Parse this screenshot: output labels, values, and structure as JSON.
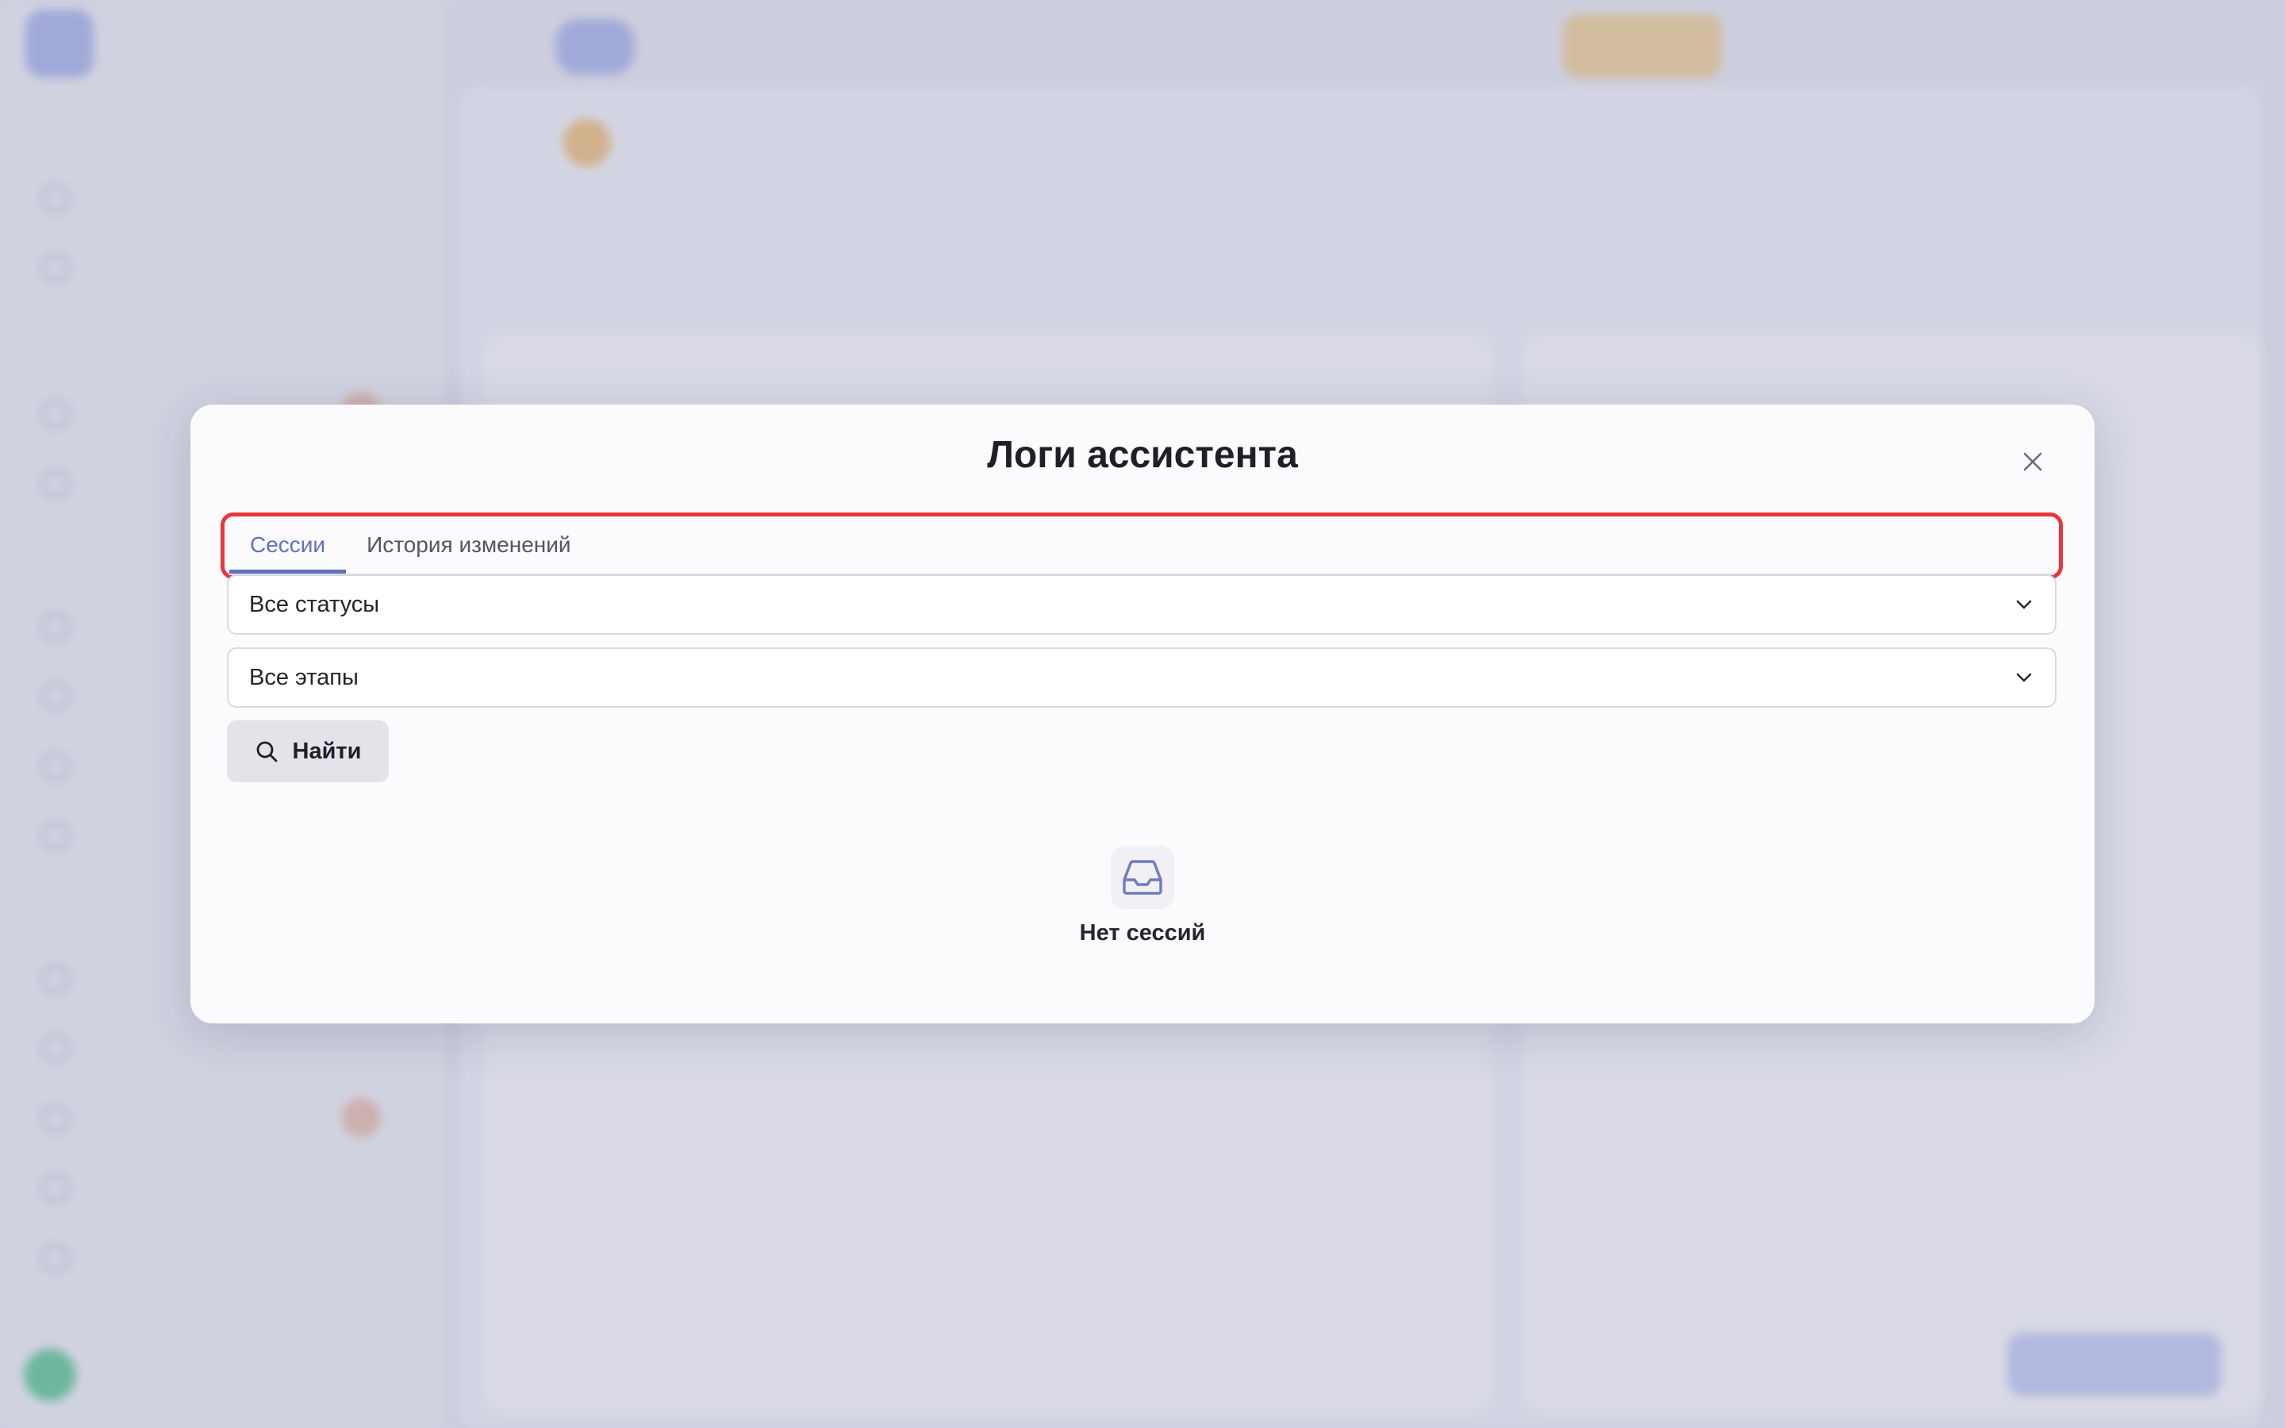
{
  "modal": {
    "title": "Логи ассистента",
    "close_icon": "close-icon",
    "tabs": [
      {
        "label": "Сессии",
        "active": true
      },
      {
        "label": "История изменений",
        "active": false
      }
    ],
    "status_filter": {
      "selected": "Все статусы"
    },
    "stage_filter": {
      "selected": "Все этапы"
    },
    "search_button": {
      "label": "Найти",
      "icon": "search-icon"
    },
    "empty_state": {
      "icon": "inbox-icon",
      "text": "Нет сессий"
    }
  },
  "colors": {
    "accent": "#6171ba",
    "highlight_border": "#e8363b",
    "overlay": "#aaacc8"
  }
}
